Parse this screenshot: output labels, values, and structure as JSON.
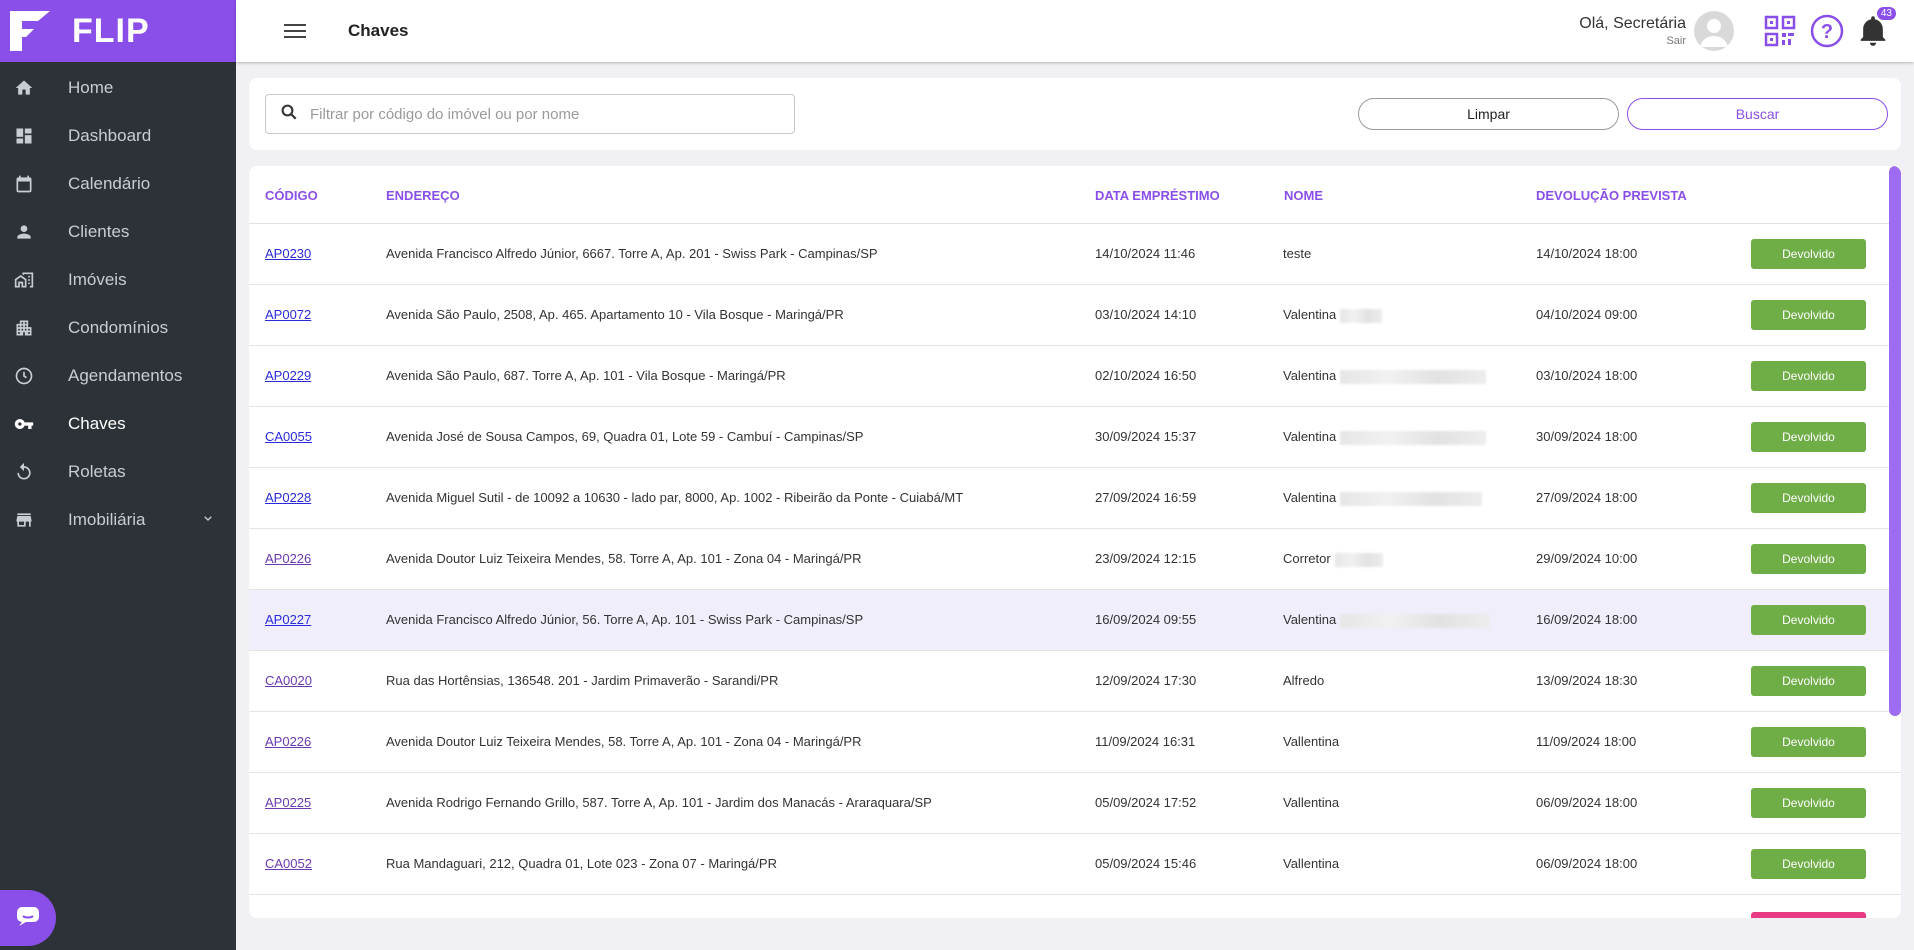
{
  "brand": {
    "name": "FLIP",
    "color": "#8a4fe8"
  },
  "sidebar": {
    "items": [
      {
        "label": "Home",
        "icon": "home-icon"
      },
      {
        "label": "Dashboard",
        "icon": "dashboard-icon"
      },
      {
        "label": "Calendário",
        "icon": "calendar-icon"
      },
      {
        "label": "Clientes",
        "icon": "person-icon"
      },
      {
        "label": "Imóveis",
        "icon": "building-icon"
      },
      {
        "label": "Condomínios",
        "icon": "apartment-icon"
      },
      {
        "label": "Agendamentos",
        "icon": "clock-icon"
      },
      {
        "label": "Chaves",
        "icon": "key-icon",
        "active": true
      },
      {
        "label": "Roletas",
        "icon": "rotate-icon"
      },
      {
        "label": "Imobiliária",
        "icon": "store-icon",
        "expandable": true
      }
    ]
  },
  "header": {
    "title": "Chaves",
    "greeting": "Olá, Secretária",
    "logout": "Sair",
    "notification_count": "43"
  },
  "filter": {
    "placeholder": "Filtrar por código do imóvel ou por nome",
    "value": "",
    "clear_label": "Limpar",
    "search_label": "Buscar"
  },
  "table": {
    "columns": [
      "CÓDIGO",
      "ENDEREÇO",
      "DATA EMPRÉSTIMO",
      "NOME",
      "DEVOLUÇÃO PREVISTA"
    ],
    "rows": [
      {
        "code": "AP0230",
        "address": "Avenida Francisco Alfredo Júnior, 6667. Torre A, Ap. 201 - Swiss Park - Campinas/SP",
        "loan_date": "14/10/2024 11:46",
        "name": "teste",
        "return_date": "14/10/2024 18:00",
        "status": "Devolvido"
      },
      {
        "code": "AP0072",
        "address": "Avenida São Paulo, 2508, Ap. 465. Apartamento 10 - Vila Bosque - Maringá/PR",
        "loan_date": "03/10/2024 14:10",
        "name": "Valentina",
        "return_date": "04/10/2024 09:00",
        "status": "Devolvido"
      },
      {
        "code": "AP0229",
        "address": "Avenida São Paulo, 687. Torre A, Ap. 101 - Vila Bosque - Maringá/PR",
        "loan_date": "02/10/2024 16:50",
        "name": "Valentina",
        "return_date": "03/10/2024 18:00",
        "status": "Devolvido"
      },
      {
        "code": "CA0055",
        "address": "Avenida José de Sousa Campos, 69, Quadra 01, Lote 59 - Cambuí - Campinas/SP",
        "loan_date": "30/09/2024 15:37",
        "name": "Valentina",
        "return_date": "30/09/2024 18:00",
        "status": "Devolvido"
      },
      {
        "code": "AP0228",
        "address": "Avenida Miguel Sutil - de 10092 a 10630 - lado par, 8000, Ap. 1002 - Ribeirão da Ponte - Cuiabá/MT",
        "loan_date": "27/09/2024 16:59",
        "name": "Valentina",
        "return_date": "27/09/2024 18:00",
        "status": "Devolvido"
      },
      {
        "code": "AP0226",
        "address": "Avenida Doutor Luiz Teixeira Mendes, 58. Torre A, Ap. 101 - Zona 04 - Maringá/PR",
        "loan_date": "23/09/2024 12:15",
        "name": "Corretor",
        "return_date": "29/09/2024 10:00",
        "status": "Devolvido"
      },
      {
        "code": "AP0227",
        "address": "Avenida Francisco Alfredo Júnior, 56. Torre A, Ap. 101 - Swiss Park - Campinas/SP",
        "loan_date": "16/09/2024 09:55",
        "name": "Valentina",
        "return_date": "16/09/2024 18:00",
        "status": "Devolvido"
      },
      {
        "code": "CA0020",
        "address": "Rua das Hortênsias, 136548. 201 - Jardim Primaverão - Sarandi/PR",
        "loan_date": "12/09/2024 17:30",
        "name": "Alfredo",
        "return_date": "13/09/2024 18:30",
        "status": "Devolvido"
      },
      {
        "code": "AP0226",
        "address": "Avenida Doutor Luiz Teixeira Mendes, 58. Torre A, Ap. 101 - Zona 04 - Maringá/PR",
        "loan_date": "11/09/2024 16:31",
        "name": "Vallentina",
        "return_date": "11/09/2024 18:00",
        "status": "Devolvido"
      },
      {
        "code": "AP0225",
        "address": "Avenida Rodrigo Fernando Grillo, 587. Torre A, Ap. 101 - Jardim dos Manacás - Araraquara/SP",
        "loan_date": "05/09/2024 17:52",
        "name": "Vallentina",
        "return_date": "06/09/2024 18:00",
        "status": "Devolvido"
      },
      {
        "code": "CA0052",
        "address": "Rua Mandaguari, 212, Quadra 01, Lote 023 - Zona 07 - Maringá/PR",
        "loan_date": "05/09/2024 15:46",
        "name": "Vallentina",
        "return_date": "06/09/2024 18:00",
        "status": "Devolvido"
      }
    ]
  },
  "colors": {
    "accent": "#8a4fe8",
    "sidebar_bg": "#2d3239",
    "status_returned": "#6fad46",
    "status_pending": "#e73c83",
    "link": "#2a2adb"
  }
}
